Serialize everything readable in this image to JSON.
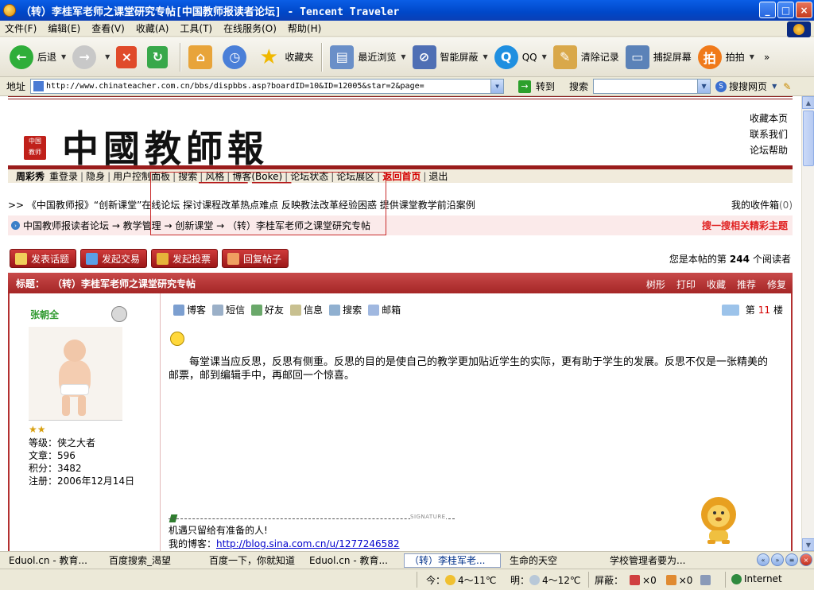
{
  "window": {
    "title": "（转）李桂军老师之课堂研究专帖[中国教师报读者论坛] - Tencent Traveler",
    "controls": {
      "minimize": "_",
      "maximize": "□",
      "close": "×"
    }
  },
  "menubar": {
    "items": [
      "文件(F)",
      "编辑(E)",
      "查看(V)",
      "收藏(A)",
      "工具(T)",
      "在线服务(O)",
      "帮助(H)"
    ]
  },
  "toolbar": {
    "back": "后退",
    "favorites": "收藏夹",
    "recent": "最近浏览",
    "adblock": "智能屏蔽",
    "qq": "QQ",
    "clear": "清除记录",
    "capture": "捕捉屏幕",
    "paipai": "拍拍",
    "paipai_glyph": "拍",
    "more": "»"
  },
  "addressbar": {
    "label": "地址",
    "url": "http://www.chinateacher.com.cn/bbs/dispbbs.asp?boardID=10&ID=12005&star=2&page=",
    "go": "转到",
    "search_label": "搜索",
    "search_value": "",
    "search_web": "搜搜网页"
  },
  "site": {
    "logo": "中國教師報",
    "seal": "中国教师报",
    "header_links": [
      "收藏本页",
      "联系我们",
      "论坛帮助"
    ],
    "nav": [
      {
        "label": "周彩秀",
        "style": "bold"
      },
      {
        "label": "重登录"
      },
      {
        "label": "隐身"
      },
      {
        "label": "用户控制面板"
      },
      {
        "label": "搜索"
      },
      {
        "label": "风格"
      },
      {
        "label": "博客(Boke)"
      },
      {
        "label": "论坛状态"
      },
      {
        "label": "论坛展区"
      },
      {
        "label": "返回首页",
        "style": "red"
      },
      {
        "label": "退出"
      }
    ],
    "marquee": ">> 《中国教师报》“创新课堂”在线论坛 探讨课程改革热点难点 反映教法改革经验困惑 提供课堂教学前沿案例",
    "inbox_label": "我的收件箱",
    "inbox_count": "(0)",
    "breadcrumb": "中国教师报读者论坛 → 教学管理 → 创新课堂 → （转）李桂军老师之课堂研究专帖",
    "search_related": "搜一搜相关精彩主题"
  },
  "actions": {
    "buttons": [
      "发表话题",
      "发起交易",
      "发起投票",
      "回复帖子"
    ],
    "reader_prefix": "您是本帖的第",
    "reader_count": "244",
    "reader_suffix": "个阅读者"
  },
  "post": {
    "title_label": "标题：",
    "title": "（转）李桂军老师之课堂研究专帖",
    "title_actions": [
      "树形",
      "打印",
      "收藏",
      "推荐",
      "修复"
    ],
    "author": {
      "name": "张朝全",
      "stars": "★★",
      "stats": [
        "等级：侠之大者",
        "文章：596",
        "积分：3482",
        "注册：2006年12月14日"
      ]
    },
    "tools": [
      "博客",
      "短信",
      "好友",
      "信息",
      "搜索",
      "邮箱"
    ],
    "floor_prefix": "第",
    "floor_num": "11",
    "floor_suffix": "楼",
    "body": "每堂课当应反思，反思有侧重。反思的目的是使自己的教学更加贴近学生的实际，更有助于学生的发展。反思不仅是一张精美的邮票，邮到编辑手中，再邮回一个惊喜。",
    "signature_label": "SIGNATURE",
    "signature_line1": "机遇只留给有准备的人!",
    "signature_blog_prefix": "我的博客：",
    "signature_blog_url": "http://blog.sina.com.cn/u/1277246582"
  },
  "tabs": [
    {
      "label": "Eduol.cn - 教育..."
    },
    {
      "label": "百度搜索_渴望"
    },
    {
      "label": "百度一下，你就知道"
    },
    {
      "label": "Eduol.cn - 教育..."
    },
    {
      "label": "（转）李桂军老...",
      "active": true
    },
    {
      "label": "生命的天空"
    },
    {
      "label": "学校管理者要为..."
    }
  ],
  "statusbar": {
    "today": "今：",
    "today_temp": "4～11℃",
    "tomorrow": "明：",
    "tomorrow_temp": "4～12℃",
    "block_label": "屏蔽：",
    "block_popups": "×0",
    "block_ads": "×0",
    "zone": "Internet"
  },
  "colors": {
    "titlebar": "#0047c8",
    "forum_red": "#a52626",
    "link_red": "#d40000",
    "author_green": "#2f9a2f"
  }
}
